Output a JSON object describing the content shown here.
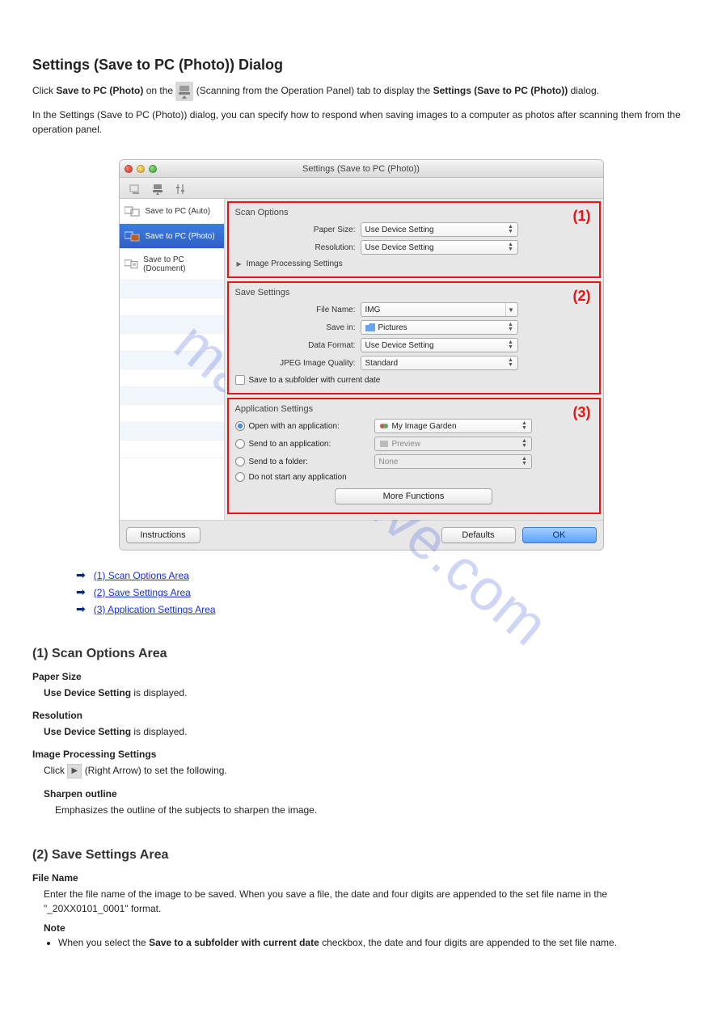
{
  "intro": {
    "heading": "Settings (Save to PC (Photo)) Dialog",
    "line1_a": "Click ",
    "line1_b": " (Scanning from the Operation Panel) tab.",
    "line1_prefix": "Save to PC (Photo)",
    "line1_suffix": " on the ",
    "line1_end": "Settings (Save to PC (Photo))",
    "line2": "In the Settings (Save to PC (Photo)) dialog, you can specify how to respond when saving images to a computer as photos after scanning them from the operation panel.",
    "text_full_1": "Click Save to PC (Photo) on the  (Scanning from the Operation Panel) tab to display the Settings (Save to PC (Photo)) dialog.",
    "text_full_2": "In the Settings (Save to PC (Photo)) dialog, you can specify how to respond when saving images to a computer as photos after scanning them from the operation panel."
  },
  "dialog": {
    "title": "Settings (Save to PC (Photo))",
    "sidebar": {
      "items": [
        {
          "label": "Save to PC (Auto)"
        },
        {
          "label": "Save to PC (Photo)"
        },
        {
          "label": "Save to PC (Document)"
        }
      ]
    },
    "scan_options": {
      "title": "Scan Options",
      "marker": "(1)",
      "paper_size_label": "Paper Size:",
      "paper_size_value": "Use Device Setting",
      "resolution_label": "Resolution:",
      "resolution_value": "Use Device Setting",
      "ips": "Image Processing Settings"
    },
    "save_settings": {
      "title": "Save Settings",
      "marker": "(2)",
      "file_name_label": "File Name:",
      "file_name_value": "IMG",
      "save_in_label": "Save in:",
      "save_in_value": "Pictures",
      "data_format_label": "Data Format:",
      "data_format_value": "Use Device Setting",
      "jpeg_q_label": "JPEG Image Quality:",
      "jpeg_q_value": "Standard",
      "subfolder_label": "Save to a subfolder with current date"
    },
    "app_settings": {
      "title": "Application Settings",
      "marker": "(3)",
      "open_with_label": "Open with an application:",
      "open_with_value": "My Image Garden",
      "send_app_label": "Send to an application:",
      "send_app_value": "Preview",
      "send_folder_label": "Send to a folder:",
      "send_folder_value": "None",
      "do_not_start_label": "Do not start any application",
      "more_functions": "More Functions"
    },
    "footer": {
      "instructions": "Instructions",
      "defaults": "Defaults",
      "ok": "OK"
    }
  },
  "links": {
    "l1": "(1) Scan Options Area",
    "l2": "(2) Save Settings Area",
    "l3": "(3) Application Settings Area"
  },
  "section1": {
    "heading": "(1) Scan Options Area",
    "paper_size": "Paper Size",
    "paper_size_desc": "Use Device Setting is displayed.",
    "resolution": "Resolution",
    "resolution_desc": "Use Device Setting is displayed.",
    "ips": "Image Processing Settings",
    "ips_desc_a": "Click ",
    "ips_desc_b": " (Right Arrow) to set the following.",
    "sharpen": "Sharpen outline",
    "sharpen_desc": "Emphasizes the outline of the subjects to sharpen the image."
  },
  "section2": {
    "heading": "(2) Save Settings Area",
    "file_name": "File Name",
    "file_name_desc": "Enter the file name of the image to be saved. When you save a file, the date and four digits are appended to the set file name in the \"_20XX0101_0001\" format.",
    "note_label": "Note",
    "note_text": "When you select the Save to a subfolder with current date checkbox, the date and four digits are appended to the set file name."
  },
  "watermark": "manualshive.com"
}
